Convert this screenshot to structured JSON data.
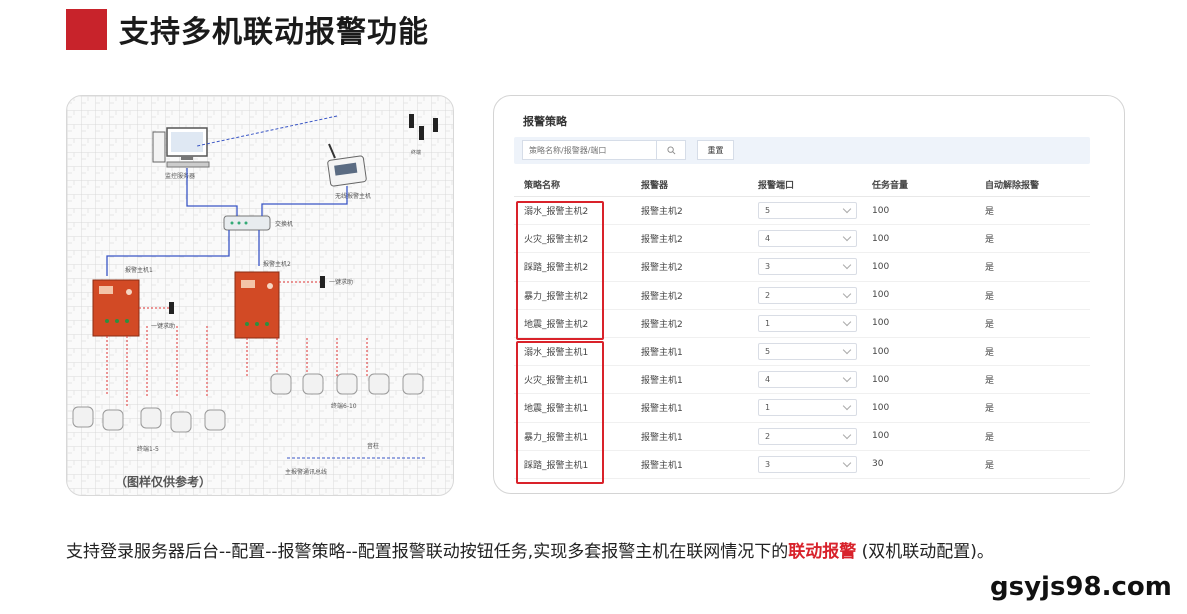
{
  "header": {
    "title": "支持多机联动报警功能"
  },
  "diagram": {
    "caption": "（图样仅供参考）",
    "labels": {
      "monitor_pc": "监控服务器",
      "switch": "交换机",
      "wireless": "无线报警主机",
      "host1": "报警主机1",
      "host2": "报警主机2",
      "terminal1": "一键求助",
      "terminal2": "一键求助",
      "terminals_a": "终端1-5",
      "terminals_b": "终端6-10",
      "speakers": "音柱",
      "bus": "主报警通讯总线"
    }
  },
  "panel": {
    "title": "报警策略",
    "search_placeholder": "策略名称/报警器/端口",
    "reset_label": "重置",
    "columns": [
      "策略名称",
      "报警器",
      "报警端口",
      "任务音量",
      "自动解除报警"
    ],
    "rows": [
      {
        "name": "溺水_报警主机2",
        "device": "报警主机2",
        "port": "5",
        "volume": "100",
        "auto": "是"
      },
      {
        "name": "火灾_报警主机2",
        "device": "报警主机2",
        "port": "4",
        "volume": "100",
        "auto": "是"
      },
      {
        "name": "踩踏_报警主机2",
        "device": "报警主机2",
        "port": "3",
        "volume": "100",
        "auto": "是"
      },
      {
        "name": "暴力_报警主机2",
        "device": "报警主机2",
        "port": "2",
        "volume": "100",
        "auto": "是"
      },
      {
        "name": "地震_报警主机2",
        "device": "报警主机2",
        "port": "1",
        "volume": "100",
        "auto": "是"
      },
      {
        "name": "溺水_报警主机1",
        "device": "报警主机1",
        "port": "5",
        "volume": "100",
        "auto": "是"
      },
      {
        "name": "火灾_报警主机1",
        "device": "报警主机1",
        "port": "4",
        "volume": "100",
        "auto": "是"
      },
      {
        "name": "地震_报警主机1",
        "device": "报警主机1",
        "port": "1",
        "volume": "100",
        "auto": "是"
      },
      {
        "name": "暴力_报警主机1",
        "device": "报警主机1",
        "port": "2",
        "volume": "100",
        "auto": "是"
      },
      {
        "name": "踩踏_报警主机1",
        "device": "报警主机1",
        "port": "3",
        "volume": "30",
        "auto": "是"
      }
    ]
  },
  "description": {
    "text": "支持登录服务器后台--配置--报警策略--配置报警联动按钮任务,实现多套报警主机在联网情况下的",
    "highlight": "联动报警",
    "suffix": " (双机联动配置)。"
  },
  "watermark": "gsyjs98.com",
  "colors": {
    "accent": "#c8232b",
    "highlight": "#d8222b",
    "cabinet": "#d24a25",
    "filter_bg": "#eef3fa"
  }
}
